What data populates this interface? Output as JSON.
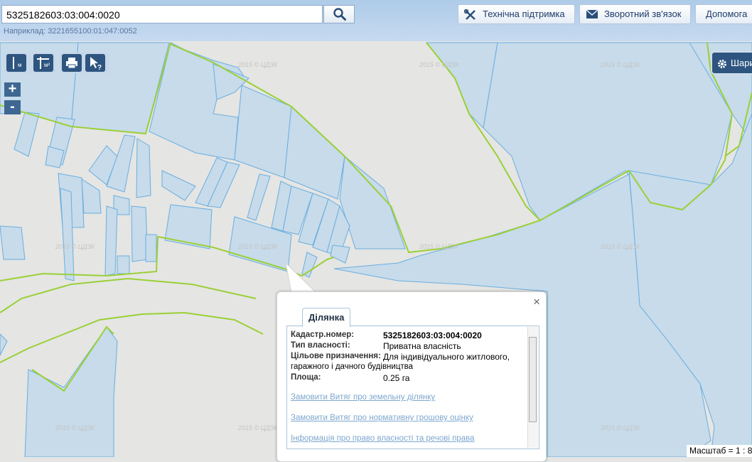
{
  "search": {
    "value": "5325182603:03:004:0020",
    "hint_label": "Наприклад:",
    "hint_value": "3221655100:01:047:0052"
  },
  "header_buttons": [
    {
      "label": "Технічна підтримка",
      "icon": "tools-icon"
    },
    {
      "label": "Зворотний зв'язок",
      "icon": "envelope-icon"
    },
    {
      "label": "Допомога",
      "icon": "none"
    }
  ],
  "map_tools": {
    "measure_length_label": "м",
    "measure_area_label": "м²",
    "print_icon": "printer-icon",
    "identify_icon": "pointer-question-icon",
    "zoom_in": "+",
    "zoom_out": "-",
    "layers_label": "Шари",
    "layers_icon": "gear-icon"
  },
  "watermark": "2015 © ЦДЗК",
  "popup": {
    "tab_title": "Ділянка",
    "close_symbol": "×",
    "fields": [
      {
        "key": "Кадастр.номер:",
        "value": "5325182603:03:004:0020"
      },
      {
        "key": "Тип власності:",
        "value": "Приватна власність"
      },
      {
        "key": "Цільове призначення:",
        "value": "Для індивідуального житлового,"
      },
      {
        "key": "",
        "value": "гаражного і дачного будівництва"
      },
      {
        "key": "Площа:",
        "value": "0.25 га"
      }
    ],
    "wrap_line": "гаражного і дачного будівництва",
    "links": [
      "Замовити Витяг про земельну ділянку",
      "Замовити Витяг про нормативну грошову оцінку",
      "Інформація про право власності та речові права"
    ]
  },
  "scale_text": "Масштаб = 1 : 8",
  "colors": {
    "map_background": "#e5e5e3",
    "parcel_fill": "#c7dbea",
    "parcel_stroke": "#6aaee0",
    "boundary_line": "#9ad037",
    "header_bg": "#b8d1ec",
    "link": "#7da7cf"
  }
}
